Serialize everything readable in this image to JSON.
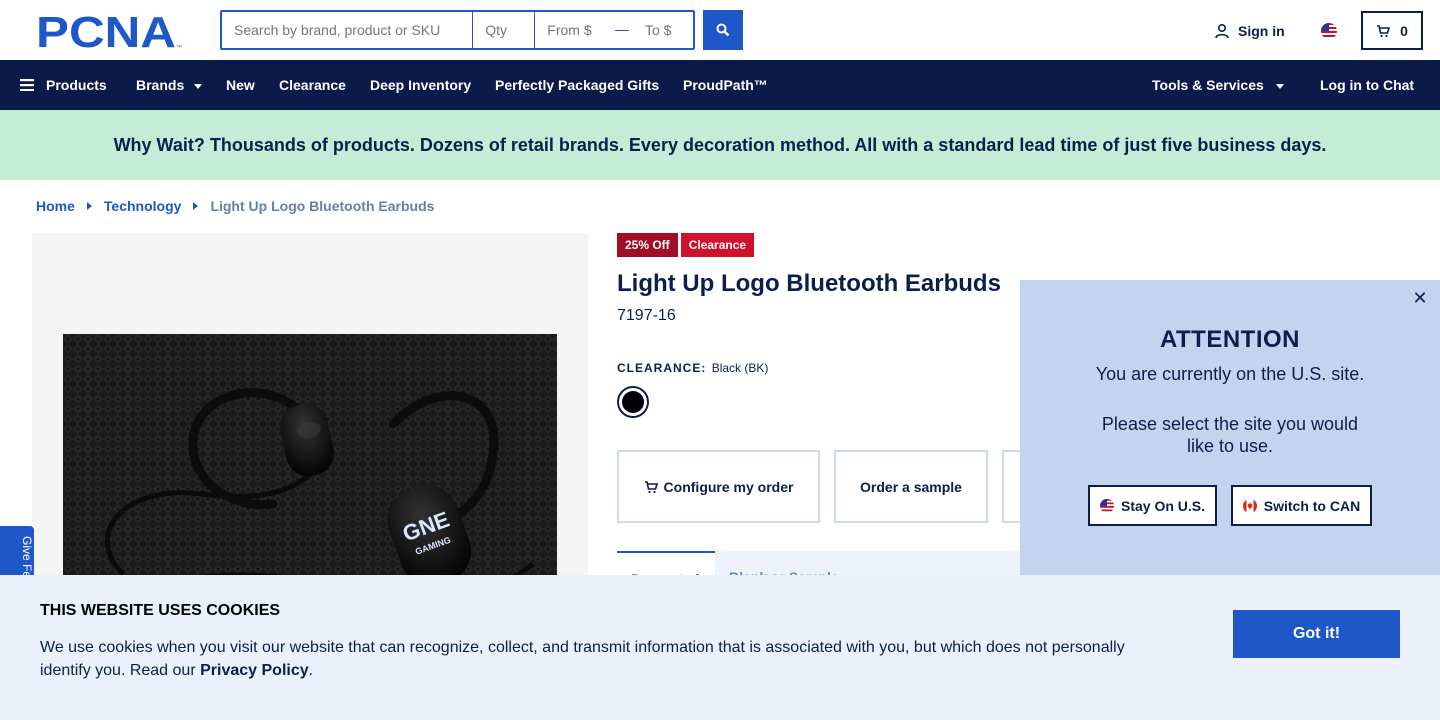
{
  "header": {
    "logo_text": "PCNA",
    "search": {
      "placeholder": "Search by brand, product or SKU",
      "qty_placeholder": "Qty",
      "from_placeholder": "From $",
      "to_placeholder": "To $"
    },
    "signin_label": "Sign in",
    "cart_count": "0"
  },
  "nav": {
    "items": [
      {
        "label": "Products"
      },
      {
        "label": "Brands"
      },
      {
        "label": "New"
      },
      {
        "label": "Clearance"
      },
      {
        "label": "Deep Inventory"
      },
      {
        "label": "Perfectly Packaged Gifts"
      },
      {
        "label": "ProudPath™"
      }
    ],
    "tools_label": "Tools & Services",
    "chat_label": "Log in to Chat"
  },
  "banner": {
    "text": "Why Wait? Thousands of products. Dozens of retail brands. Every decoration method. All with a standard lead time of just five business days."
  },
  "breadcrumb": {
    "items": [
      "Home",
      "Technology"
    ],
    "current": "Light Up Logo Bluetooth Earbuds"
  },
  "product": {
    "badges": [
      "25% Off",
      "Clearance"
    ],
    "title": "Light Up Logo Bluetooth Earbuds",
    "sku": "7197-16",
    "color_label": "CLEARANCE:",
    "color_value": "Black (BK)",
    "swatch_color": "#000000",
    "actions": {
      "configure": "Configure my order",
      "sample": "Order a sample"
    },
    "tabs": [
      "Decorated",
      "Blank or Sample"
    ],
    "image_logo_text": [
      "GNE",
      "GAMING"
    ]
  },
  "feedback": {
    "label": "Give Feedback"
  },
  "modal": {
    "title": "ATTENTION",
    "line1": "You are currently on the U.S. site.",
    "line2": "Please select the site you would like to use.",
    "stay_label": "Stay On U.S.",
    "switch_label": "Switch to CAN"
  },
  "cookie": {
    "title": "THIS WEBSITE USES COOKIES",
    "text": "We use cookies when you visit our website that can recognize, collect, and transmit information that is associated with you, but which does not personally identify you. Read our",
    "link": "Privacy Policy",
    "period": ".",
    "button": "Got it!"
  },
  "colors": {
    "navy": "#0a1a4b",
    "accent": "#1e58c8",
    "banner": "#c4ecd6",
    "badge_red": "#d0112b",
    "modal_bg": "#c3d4ee",
    "cookie_bg": "#eaf1fb"
  }
}
